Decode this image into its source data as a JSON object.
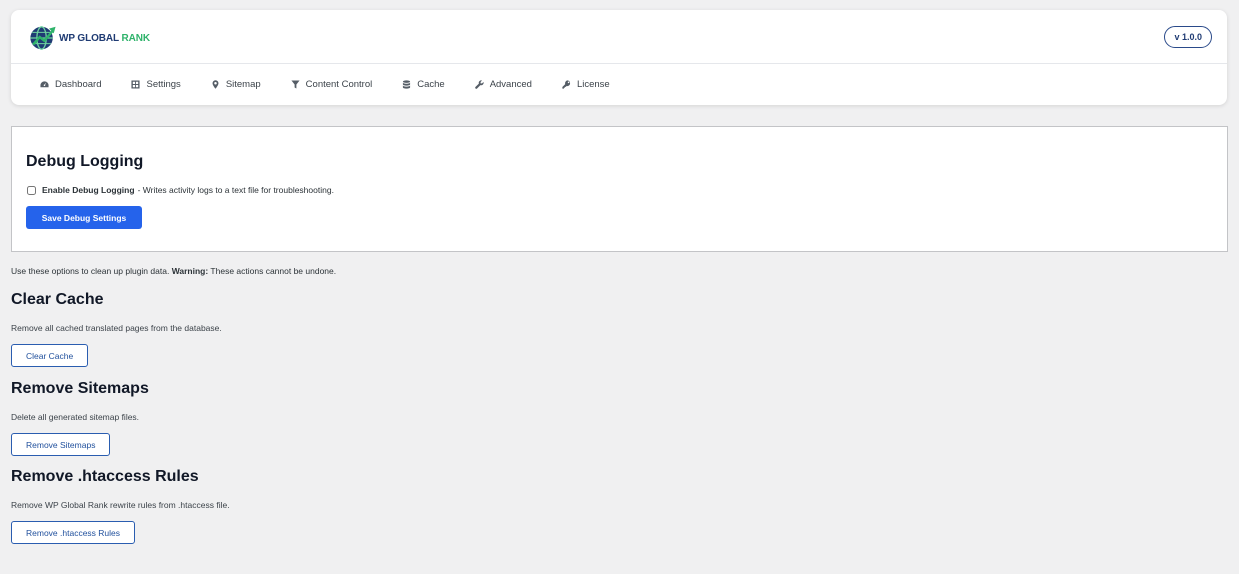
{
  "header": {
    "brand_prefix": "WP GLOBAL ",
    "brand_suffix": "RANK",
    "version": "v 1.0.0",
    "nav": [
      {
        "label": "Dashboard",
        "icon": "dashboard-icon"
      },
      {
        "label": "Settings",
        "icon": "settings-icon"
      },
      {
        "label": "Sitemap",
        "icon": "location-pin-icon"
      },
      {
        "label": "Content Control",
        "icon": "filter-icon"
      },
      {
        "label": "Cache",
        "icon": "database-icon"
      },
      {
        "label": "Advanced",
        "icon": "wrench-icon"
      },
      {
        "label": "License",
        "icon": "key-icon"
      }
    ]
  },
  "debug": {
    "title": "Debug Logging",
    "checkbox_label": "Enable Debug Logging",
    "checkbox_desc": "- Writes activity logs to a text file for troubleshooting.",
    "checked": false,
    "save_label": "Save Debug Settings"
  },
  "cleanup": {
    "intro_prefix": "Use these options to clean up plugin data.",
    "warning_label": "Warning:",
    "warning_text": "These actions cannot be undone.",
    "sections": [
      {
        "title": "Clear Cache",
        "desc": "Remove all cached translated pages from the database.",
        "button": "Clear Cache"
      },
      {
        "title": "Remove Sitemaps",
        "desc": "Delete all generated sitemap files.",
        "button": "Remove Sitemaps"
      },
      {
        "title": "Remove .htaccess Rules",
        "desc": "Remove WP Global Rank rewrite rules from .htaccess file.",
        "button": "Remove .htaccess Rules"
      }
    ]
  },
  "colors": {
    "primary": "#2563eb",
    "brand_dark": "#1f3b73",
    "brand_green": "#2fb36b",
    "background": "#f0f0f1"
  }
}
